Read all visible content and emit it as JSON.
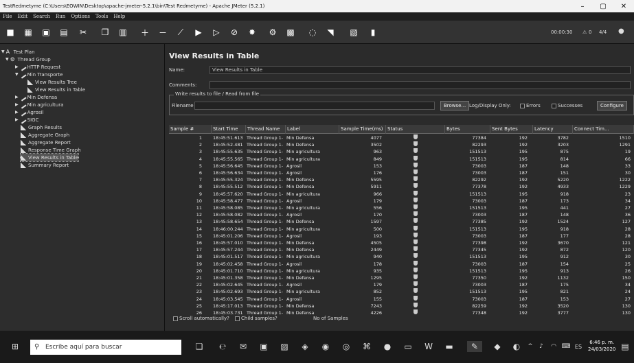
{
  "window": {
    "title": "TestRedmetyme (C:\\Users\\EOWIN\\Desktop\\apache-jmeter-5.2.1\\bin\\Test Redmetyme) - Apache JMeter (5.2.1)",
    "minimize": "–",
    "maximize": "▢",
    "close": "✕"
  },
  "menu": [
    "File",
    "Edit",
    "Search",
    "Run",
    "Options",
    "Tools",
    "Help"
  ],
  "toolbar": {
    "timer": "00:00:30",
    "warnings": "0",
    "threads": "4/4"
  },
  "tree": [
    {
      "label": "Test Plan",
      "level": 0,
      "icon": "testplan"
    },
    {
      "label": "Thread Group",
      "level": 1,
      "icon": "gear"
    },
    {
      "label": "HTTP Request",
      "level": 2,
      "icon": "sampler"
    },
    {
      "label": "Min Transporte",
      "level": 2,
      "icon": "sampler"
    },
    {
      "label": "View Results Tree",
      "level": 3,
      "icon": "listener"
    },
    {
      "label": "View Results in Table",
      "level": 3,
      "icon": "listener"
    },
    {
      "label": "Min Defensa",
      "level": 2,
      "icon": "sampler"
    },
    {
      "label": "Min agricultura",
      "level": 2,
      "icon": "sampler"
    },
    {
      "label": "Agrosil",
      "level": 2,
      "icon": "sampler"
    },
    {
      "label": "SIGC",
      "level": 2,
      "icon": "sampler"
    },
    {
      "label": "Graph Results",
      "level": 1,
      "icon": "listener"
    },
    {
      "label": "Aggregate Graph",
      "level": 1,
      "icon": "listener"
    },
    {
      "label": "Aggregate Report",
      "level": 1,
      "icon": "listener"
    },
    {
      "label": "Response Time Graph",
      "level": 1,
      "icon": "listener"
    },
    {
      "label": "View Results in Table",
      "level": 1,
      "icon": "listener",
      "selected": true
    },
    {
      "label": "Summary Report",
      "level": 1,
      "icon": "listener"
    }
  ],
  "panel": {
    "title": "View Results in Table",
    "name_label": "Name:",
    "name_value": "View Results in Table",
    "comments_label": "Comments:",
    "file_legend": "Write results to file / Read from file",
    "filename_label": "Filename",
    "browse": "Browse...",
    "log_display_only": "Log/Display Only:",
    "errors": "Errors",
    "successes": "Successes",
    "configure": "Configure"
  },
  "table": {
    "columns": [
      "Sample #",
      "Start Time",
      "Thread Name",
      "Label",
      "Sample Time(ms)",
      "Status",
      "Bytes",
      "Sent Bytes",
      "Latency",
      "Connect Tim..."
    ],
    "rows": [
      [
        "1",
        "18:45:51.613",
        "Thread Group 1-",
        "Min Defensa",
        "4077",
        "",
        "77384",
        "192",
        "3782",
        "1510"
      ],
      [
        "2",
        "18:45:52.481",
        "Thread Group 1-",
        "Min Defensa",
        "3502",
        "",
        "82293",
        "192",
        "3203",
        "1291"
      ],
      [
        "3",
        "18:45:55.635",
        "Thread Group 1-",
        "Min agricultura",
        "963",
        "",
        "151513",
        "195",
        "875",
        "19"
      ],
      [
        "4",
        "18:45:55.565",
        "Thread Group 1-",
        "Min agricultura",
        "849",
        "",
        "151513",
        "195",
        "814",
        "66"
      ],
      [
        "5",
        "18:45:56.645",
        "Thread Group 1-",
        "Agrosil",
        "153",
        "",
        "73003",
        "187",
        "148",
        "33"
      ],
      [
        "6",
        "18:45:56.634",
        "Thread Group 1-",
        "Agrosil",
        "176",
        "",
        "73003",
        "187",
        "151",
        "30"
      ],
      [
        "7",
        "18:45:55.324",
        "Thread Group 1-",
        "Min Defensa",
        "5595",
        "",
        "82292",
        "192",
        "5220",
        "1222"
      ],
      [
        "8",
        "18:45:55.512",
        "Thread Group 1-",
        "Min Defensa",
        "5911",
        "",
        "77378",
        "192",
        "4933",
        "1229"
      ],
      [
        "9",
        "18:45:57.620",
        "Thread Group 1-",
        "Min agricultura",
        "966",
        "",
        "151513",
        "195",
        "918",
        "23"
      ],
      [
        "10",
        "18:45:58.477",
        "Thread Group 1-",
        "Agrosil",
        "179",
        "",
        "73003",
        "187",
        "173",
        "34"
      ],
      [
        "11",
        "18:45:58.085",
        "Thread Group 1-",
        "Min agricultura",
        "556",
        "",
        "151513",
        "195",
        "441",
        "27"
      ],
      [
        "12",
        "18:45:58.082",
        "Thread Group 1-",
        "Agrosil",
        "170",
        "",
        "73003",
        "187",
        "148",
        "36"
      ],
      [
        "13",
        "18:45:58.654",
        "Thread Group 1-",
        "Min Defensa",
        "1597",
        "",
        "77385",
        "192",
        "1524",
        "127"
      ],
      [
        "14",
        "18:46:00.244",
        "Thread Group 1-",
        "Min agricultura",
        "500",
        "",
        "151513",
        "195",
        "918",
        "28"
      ],
      [
        "15",
        "18:45:01.206",
        "Thread Group 1-",
        "Agrosil",
        "193",
        "",
        "73003",
        "187",
        "177",
        "28"
      ],
      [
        "16",
        "18:45:57.010",
        "Thread Group 1-",
        "Min Defensa",
        "4505",
        "",
        "77398",
        "192",
        "3670",
        "121"
      ],
      [
        "17",
        "18:45:57.244",
        "Thread Group 1-",
        "Min Defensa",
        "2449",
        "",
        "77345",
        "192",
        "872",
        "120"
      ],
      [
        "18",
        "18:45:01.517",
        "Thread Group 1-",
        "Min agricultura",
        "940",
        "",
        "151513",
        "195",
        "912",
        "30"
      ],
      [
        "19",
        "18:45:02.458",
        "Thread Group 1-",
        "Agrosil",
        "178",
        "",
        "73003",
        "187",
        "154",
        "25"
      ],
      [
        "20",
        "18:45:01.710",
        "Thread Group 1-",
        "Min agricultura",
        "935",
        "",
        "151513",
        "195",
        "913",
        "26"
      ],
      [
        "21",
        "18:45:01.358",
        "Thread Group 1-",
        "Min Defensa",
        "1295",
        "",
        "77350",
        "192",
        "1132",
        "150"
      ],
      [
        "22",
        "18:45:02.645",
        "Thread Group 1-",
        "Agrosil",
        "179",
        "",
        "73003",
        "187",
        "175",
        "34"
      ],
      [
        "23",
        "18:45:02.693",
        "Thread Group 1-",
        "Min agricultura",
        "852",
        "",
        "151513",
        "195",
        "821",
        "24"
      ],
      [
        "24",
        "18:45:03.545",
        "Thread Group 1-",
        "Agrosil",
        "155",
        "",
        "73003",
        "187",
        "153",
        "27"
      ],
      [
        "25",
        "18:45:17.013",
        "Thread Group 1-",
        "Min Defensa",
        "7243",
        "",
        "82259",
        "192",
        "3520",
        "130"
      ],
      [
        "26",
        "18:45:03.731",
        "Thread Group 1-",
        "Min Defensa",
        "4226",
        "",
        "77348",
        "192",
        "3777",
        "130"
      ]
    ]
  },
  "bottom": {
    "scroll": "Scroll automatically?",
    "child": "Child samples?",
    "no_samples": "No of Samples"
  },
  "taskbar": {
    "search_placeholder": "Escribe aquí para buscar",
    "time": "6:46 p. m.",
    "date": "24/03/2020"
  }
}
